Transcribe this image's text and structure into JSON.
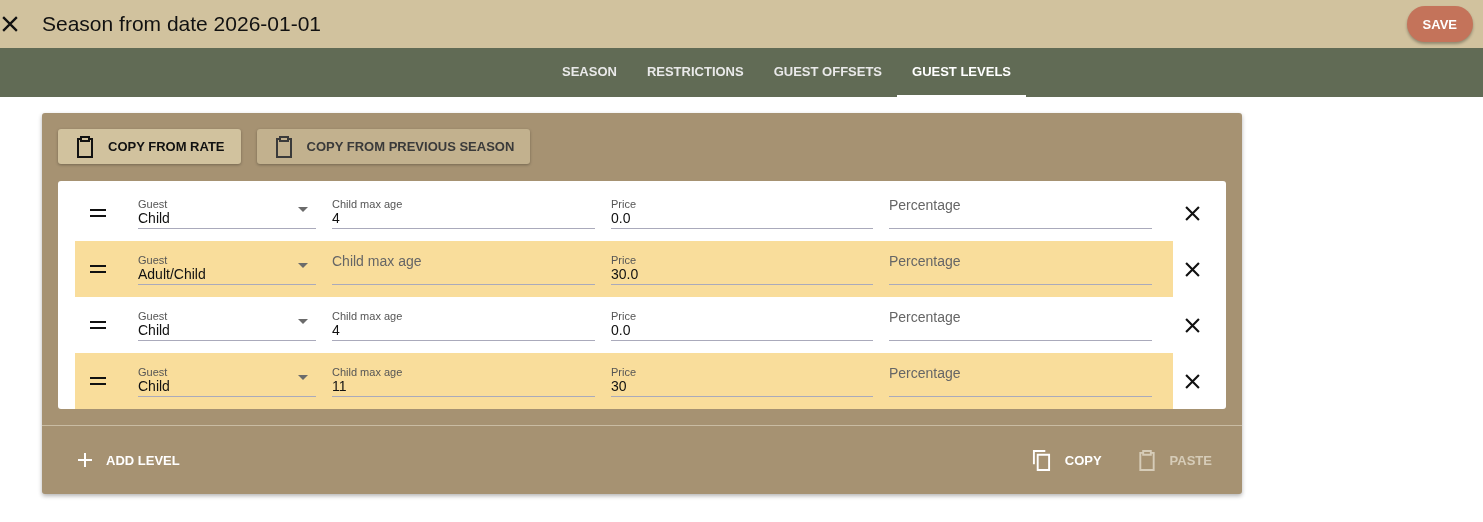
{
  "header": {
    "title": "Season from date 2026-01-01",
    "save_label": "SAVE"
  },
  "tabs": [
    {
      "label": "SEASON",
      "selected": false
    },
    {
      "label": "RESTRICTIONS",
      "selected": false
    },
    {
      "label": "GUEST OFFSETS",
      "selected": false
    },
    {
      "label": "GUEST LEVELS",
      "selected": true
    }
  ],
  "copy_buttons": [
    {
      "label": "COPY FROM RATE",
      "disabled": false
    },
    {
      "label": "COPY FROM PREVIOUS SEASON",
      "disabled": true
    }
  ],
  "levels": [
    {
      "highlighted": false,
      "guest": {
        "label": "Guest",
        "value": "Child"
      },
      "child_max_age": {
        "label": "Child max age",
        "value": "4"
      },
      "price": {
        "label": "Price",
        "value": "0.0"
      },
      "percentage": {
        "placeholder": "Percentage"
      }
    },
    {
      "highlighted": true,
      "guest": {
        "label": "Guest",
        "value": "Adult/Child"
      },
      "child_max_age": {
        "placeholder": "Child max age"
      },
      "price": {
        "label": "Price",
        "value": "30.0"
      },
      "percentage": {
        "placeholder": "Percentage"
      }
    },
    {
      "highlighted": false,
      "guest": {
        "label": "Guest",
        "value": "Child"
      },
      "child_max_age": {
        "label": "Child max age",
        "value": "4"
      },
      "price": {
        "label": "Price",
        "value": "0.0"
      },
      "percentage": {
        "placeholder": "Percentage"
      }
    },
    {
      "highlighted": true,
      "guest": {
        "label": "Guest",
        "value": "Child"
      },
      "child_max_age": {
        "label": "Child max age",
        "value": "11"
      },
      "price": {
        "label": "Price",
        "value": "30"
      },
      "percentage": {
        "placeholder": "Percentage"
      }
    }
  ],
  "footer": {
    "add_label": "ADD LEVEL",
    "copy": {
      "label": "COPY",
      "disabled": false
    },
    "paste": {
      "label": "PASTE",
      "disabled": true
    }
  }
}
